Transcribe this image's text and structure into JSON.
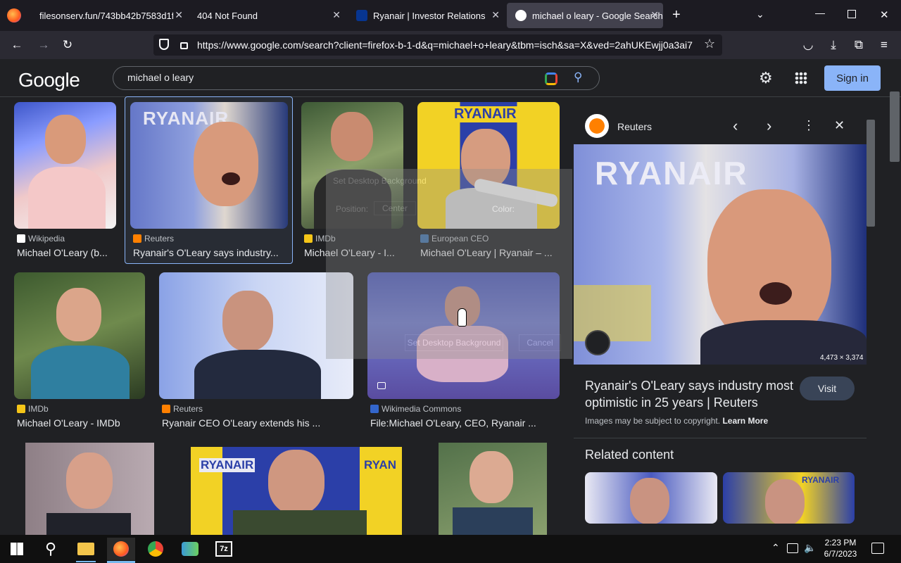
{
  "tabs": [
    {
      "title": "filesonserv.fun/743bb42b7583d1fd4",
      "favicon_color": "#3a3944"
    },
    {
      "title": "404 Not Found",
      "favicon_color": ""
    },
    {
      "title": "Ryanair | Investor Relations",
      "favicon_color": "#073590"
    },
    {
      "title": "michael o leary - Google Search",
      "favicon_color": "#ffffff"
    }
  ],
  "url": "https://www.google.com/search?client=firefox-b-1-d&q=michael+o+leary&tbm=isch&sa=X&ved=2ahUKEwjj0a3ai7",
  "google": {
    "logo": "Google",
    "query": "michael o leary",
    "signin": "Sign in"
  },
  "results": [
    {
      "source": "Wikipedia",
      "title": "Michael O'Leary (b...",
      "icon_color": "#ffffff"
    },
    {
      "source": "Reuters",
      "title": "Ryanair's O'Leary says industry...",
      "icon_color": "#ff8000"
    },
    {
      "source": "IMDb",
      "title": "Michael O'Leary - I...",
      "icon_color": "#f5c518"
    },
    {
      "source": "European CEO",
      "title": "Michael O'Leary | Ryanair – ...",
      "icon_color": "#3d6fa8"
    },
    {
      "source": "IMDb",
      "title": "Michael O'Leary - IMDb",
      "icon_color": "#f5c518"
    },
    {
      "source": "Reuters",
      "title": "Ryanair CEO O'Leary extends his ...",
      "icon_color": "#ff8000"
    },
    {
      "source": "Wikimedia Commons",
      "title": "File:Michael O'Leary, CEO, Ryanair ...",
      "icon_color": "#3366cc"
    }
  ],
  "panel": {
    "source": "Reuters",
    "dimensions": "4,473 × 3,374",
    "title": "Ryanair's O'Leary says industry most optimistic in 25 years | Reuters",
    "visit": "Visit",
    "copyright": "Images may be subject to copyright.",
    "learn_more": "Learn More",
    "related": "Related content"
  },
  "ghost_dialog": {
    "title": "Set Desktop Background",
    "position_label": "Position:",
    "position_value": "Center",
    "color_label": "Color:",
    "set_button": "Set Desktop Background",
    "cancel_button": "Cancel"
  },
  "thumb_labels": {
    "ryanair": "RYANAIR",
    "ryan": "RYAN"
  },
  "taskbar": {
    "time": "2:23 PM",
    "date": "6/7/2023"
  }
}
